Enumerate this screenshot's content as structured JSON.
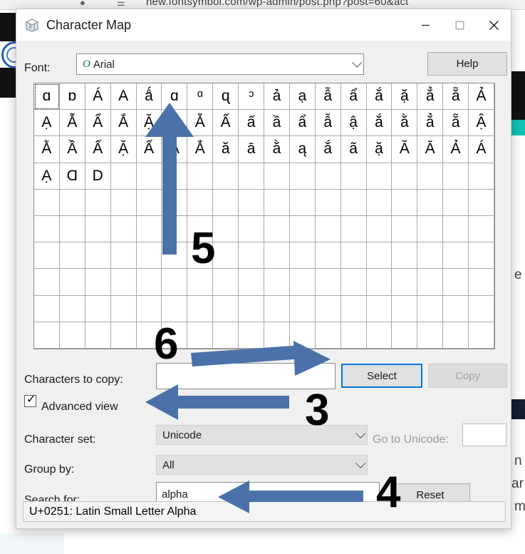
{
  "background": {
    "url_text": "new.fontsymbol.com/wp-admin/post.php?post=60&act",
    "page_snippets": [
      "e",
      "n",
      "ar",
      "m"
    ]
  },
  "window": {
    "title": "Character Map",
    "icon": "charmap-icon",
    "controls": {
      "minimize": "–",
      "maximize": "□",
      "close": "✕"
    }
  },
  "font_row": {
    "label": "Font:",
    "tt_glyph": "O",
    "value": "Arial",
    "help_button": "Help"
  },
  "grid": {
    "columns": 18,
    "rows": 10,
    "selected_index": 0,
    "characters": [
      "ɑ",
      "ɒ",
      "Á",
      "A",
      "ǻ",
      "ɑ",
      "ᵅ",
      "ɋ",
      "ᵓ",
      "ả",
      "ạ",
      "ẫ",
      "ẩ",
      "ắ",
      "ặ",
      "ẳ",
      "ẵ",
      "Ả",
      "Ạ",
      "Ẫ",
      "Ẩ",
      "Ắ",
      "Ặ",
      "Ẳ",
      "Ẵ",
      "Ấ",
      "ấ",
      "ầ",
      "ẩ",
      "ẫ",
      "ậ",
      "ắ",
      "ằ",
      "ẳ",
      "ẵ",
      "Ậ",
      "Ằ",
      "Ầ",
      "Ấ",
      "Ặ",
      "Ẩ",
      "Ẵ",
      "Ẳ",
      "ă",
      "ā",
      "ằ",
      "ą",
      "ắ",
      "ã",
      "ặ",
      "Ă",
      "Ā",
      "Ả",
      "Á",
      "Ạ",
      "Ɑ",
      "D"
    ]
  },
  "form": {
    "characters_to_copy_label": "Characters to copy:",
    "characters_to_copy_value": "",
    "select_button": "Select",
    "copy_button": "Copy",
    "advanced_view_label": "Advanced view",
    "advanced_view_checked": true,
    "character_set_label": "Character set:",
    "character_set_value": "Unicode",
    "go_to_unicode_label": "Go to Unicode:",
    "go_to_unicode_value": "",
    "group_by_label": "Group by:",
    "group_by_value": "All",
    "search_for_label": "Search for:",
    "search_for_value": "alpha",
    "reset_button": "Reset"
  },
  "status": {
    "text": "U+0251: Latin Small Letter Alpha"
  },
  "annotations": {
    "arrow_color": "#4a72a8",
    "steps": [
      {
        "number": "3",
        "direction": "left",
        "target": "advanced-view-checkbox"
      },
      {
        "number": "4",
        "direction": "left",
        "target": "search-for-input"
      },
      {
        "number": "5",
        "direction": "up",
        "target": "character-grid"
      },
      {
        "number": "6",
        "direction": "right",
        "target": "select-button"
      }
    ]
  }
}
